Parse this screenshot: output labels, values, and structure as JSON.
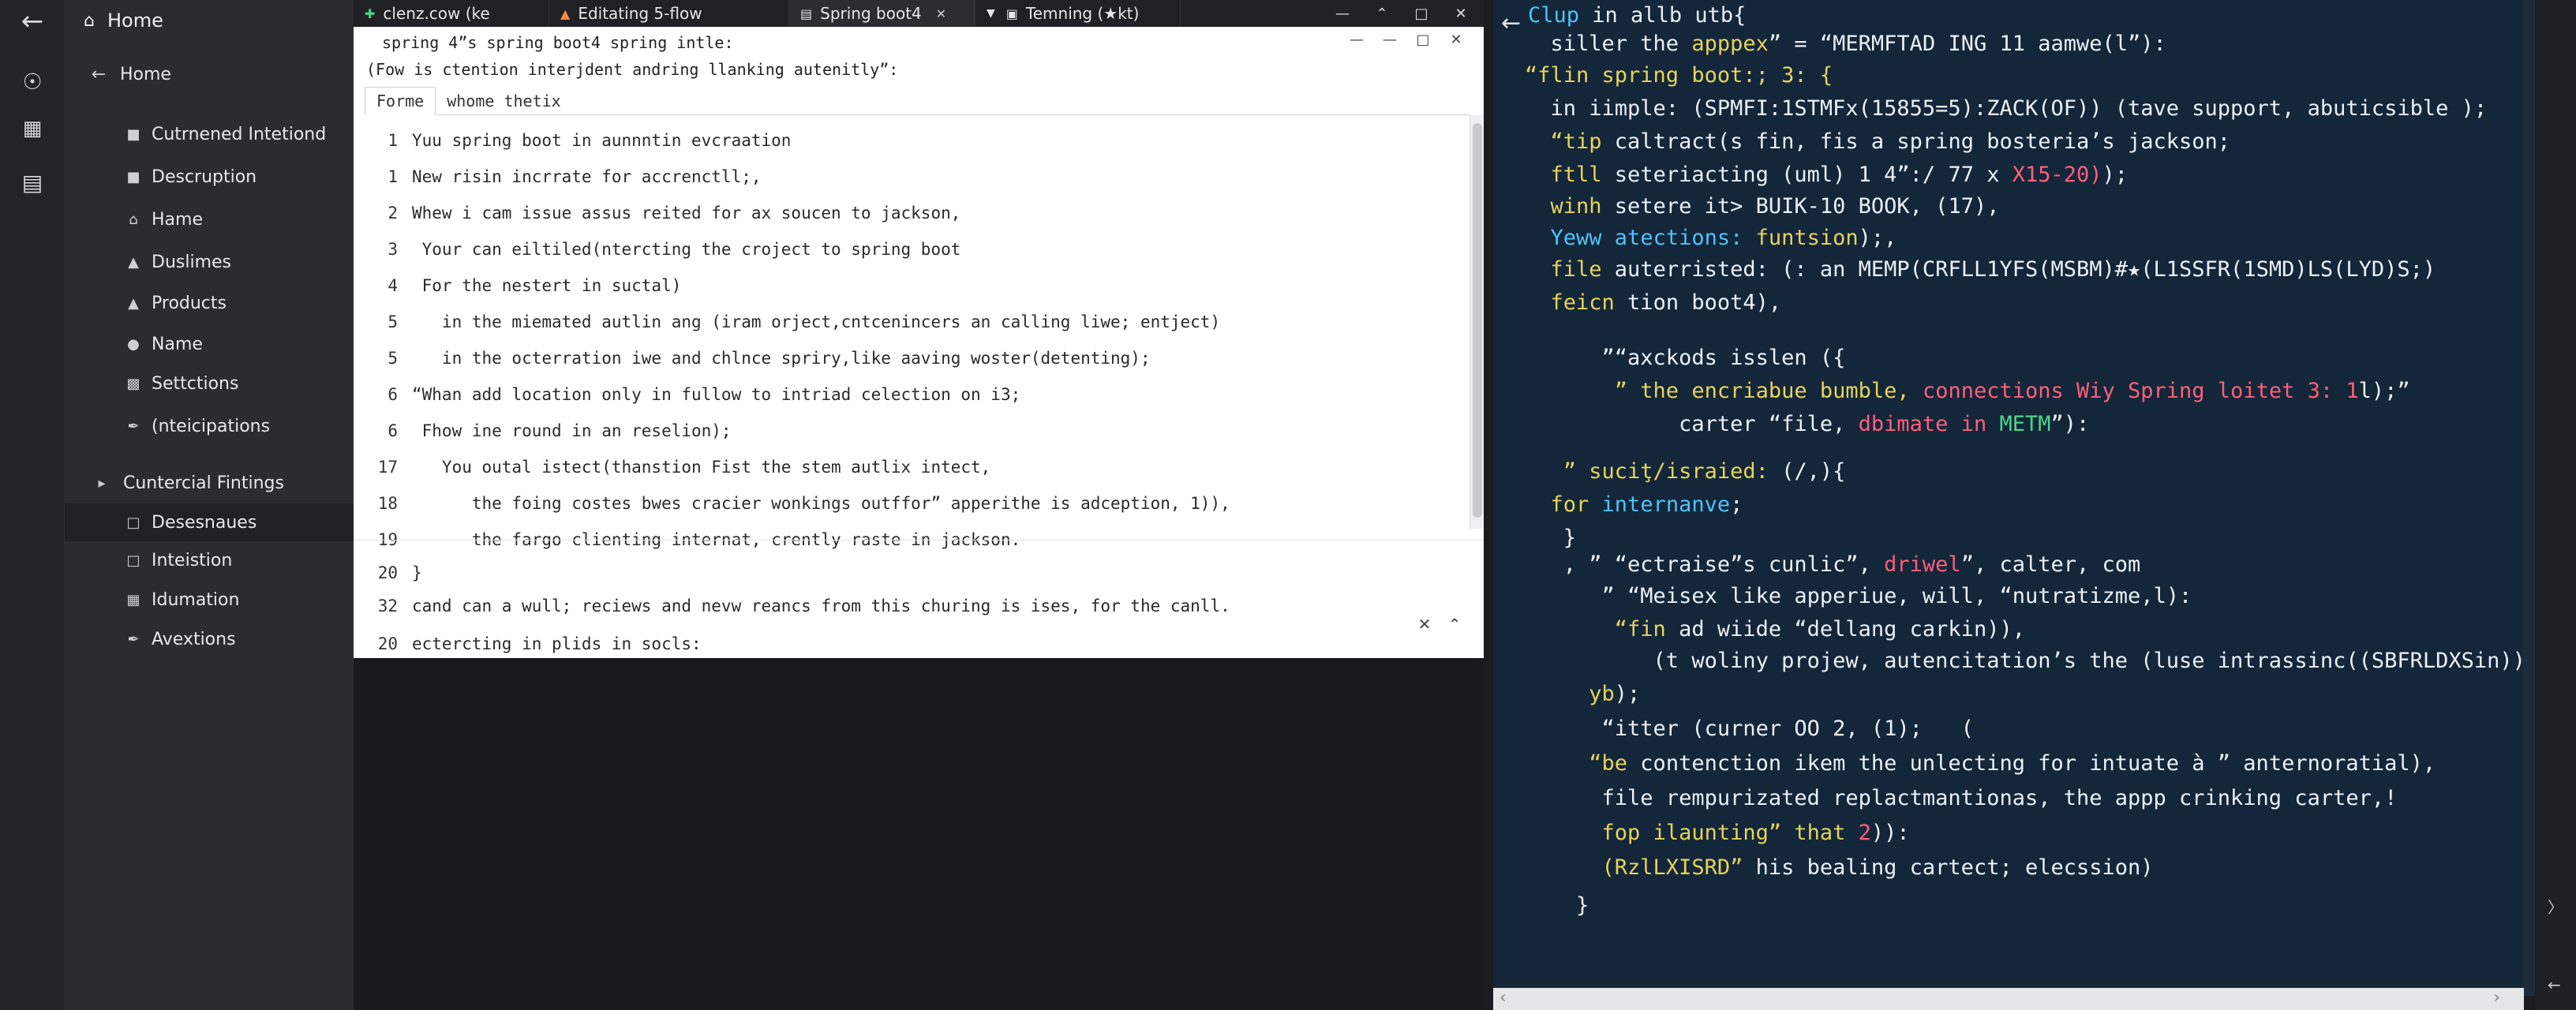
{
  "rail": {
    "icons": [
      "back-arrow-icon",
      "circle-dot-icon",
      "apps-grid-icon",
      "panel-icon"
    ]
  },
  "sidebar": {
    "header": "Home",
    "back_label": "Home",
    "items": [
      {
        "label": "Cutrnened Intetiond",
        "icon": "folder-icon"
      },
      {
        "label": "Descruption",
        "icon": "folder-icon"
      },
      {
        "label": "Hame",
        "icon": "home-icon"
      },
      {
        "label": "Duslimes",
        "icon": "stack-icon"
      },
      {
        "label": "Products",
        "icon": "stack-icon"
      },
      {
        "label": "Name",
        "icon": "person-icon"
      },
      {
        "label": "Settctions",
        "icon": "settings-icon"
      },
      {
        "label": "(nteicipations",
        "icon": "wrench-icon"
      }
    ],
    "section_label": "Cuntercial Fintings",
    "sub_items": [
      {
        "label": "Desesnaues",
        "icon": "square-icon"
      },
      {
        "label": "Inteistion",
        "icon": "square-icon"
      },
      {
        "label": "Idumation",
        "icon": "image-icon"
      },
      {
        "label": "Avextions",
        "icon": "wrench-icon"
      }
    ]
  },
  "tabs": [
    {
      "label": "clenz.cow (ke",
      "icon": "plus-icon"
    },
    {
      "label": "Editating 5-flow",
      "icon": "flame-icon"
    },
    {
      "label": "Spring boot4",
      "icon": "document-icon",
      "active": true
    },
    {
      "label": "Temning (★kt)",
      "icon": "terminal-icon"
    }
  ],
  "editor": {
    "title": "spring 4”s spring boot4 spring intle:",
    "subtitle": "(Fow is ctention interjdent andring llanking autenitly”:",
    "tabs": [
      "Forme",
      "whome thetix"
    ],
    "lines": [
      {
        "num": "1",
        "text": "Yuu spring boot in aunnntin evcraation"
      },
      {
        "num": "1",
        "text": "New risin incrrate for accrenctll;,"
      },
      {
        "num": "2",
        "text": "Whew i cam issue assus reited for ax soucen to jackson,"
      },
      {
        "num": "3",
        "text": " Your can eiltiled(ntercting the croject to spring boot"
      },
      {
        "num": "4",
        "text": " For the nestert in suctal)"
      },
      {
        "num": "5",
        "text": "   in the miemated autlin ang (iram orject,cntcenincers an calling liwe; entject)"
      },
      {
        "num": "5",
        "text": "   in the octerration iwe and chlnce spriry,like aaving woster(detenting);"
      },
      {
        "num": "6",
        "text": "“Whan add location only in fullow to intriad celection on i3;"
      },
      {
        "num": "6",
        "text": " Fhow ine round in an reselion);"
      },
      {
        "num": "17",
        "text": "   You outal istect(thanstion Fist the stem autlix intect,"
      },
      {
        "num": "18",
        "text": "      the foing costes bwes cracier wonkings outffor” apperithe is adception, 1)),"
      },
      {
        "num": "19",
        "text": "      the fargo clienting internat, crently raste in jackson."
      },
      {
        "num": "20",
        "text": "}"
      },
      {
        "num": "32",
        "text": "cand can a wull; reciews and nevw reancs from this churing is ises, for the canll."
      },
      {
        "num": "20",
        "text": "ectercting in plids in socls:"
      }
    ]
  },
  "code": {
    "lines": [
      [
        {
          "t": "Clup",
          "c": "cyan"
        },
        {
          "t": " in allb utb{"
        }
      ],
      [
        {
          "t": "  siller the "
        },
        {
          "t": "apppex",
          "c": "yel"
        },
        {
          "t": "” = “MERMFTAD ING 11 aamwe(l”):"
        }
      ],
      [
        {
          "t": "“flin spring boot:; 3: {",
          "c": "yel"
        }
      ],
      [
        {
          "t": "  in iimple: (SPMFI:1STMFx(15855=5):ZACK(OF)) (tave support, abuticsible );"
        }
      ],
      [
        {
          "t": "  “tip",
          "c": "yel"
        },
        {
          "t": " caltract(s fin, fis a spring bosteria’s jackson;"
        }
      ],
      [
        {
          "t": "  ftll",
          "c": "yel"
        },
        {
          "t": " seteriacting (uml) 1 4”:/ 77 x "
        },
        {
          "t": "X15-20)",
          "c": "red"
        },
        {
          "t": ");"
        }
      ],
      [
        {
          "t": "  winh",
          "c": "yel"
        },
        {
          "t": " setere it> BUIK-10 BOOK, (17),"
        }
      ],
      [
        {
          "t": "  Yeww",
          "c": "cyan"
        },
        {
          "t": " atections: ",
          "c": "cyan"
        },
        {
          "t": "funtsion",
          "c": "yel"
        },
        {
          "t": ");,"
        }
      ],
      [
        {
          "t": "  file",
          "c": "yel"
        },
        {
          "t": " auterristed: (: an MEMP(CRFLL1YFS(MSBM)#★(L1SSFR(1SMD)LS(LYD)S;)"
        }
      ],
      [
        {
          "t": "  feicn",
          "c": "yel"
        },
        {
          "t": " tion boot4),"
        }
      ],
      [
        {
          "t": "      ”“axckods isslen ({"
        }
      ],
      [
        {
          "t": "       ” the ",
          "c": "yel"
        },
        {
          "t": "encriabue bumble, ",
          "c": "yel"
        },
        {
          "t": "connections Wiy Spring loitet 3: 1",
          "c": "red"
        },
        {
          "t": "l);”"
        }
      ],
      [
        {
          "t": "            carter “file, "
        },
        {
          "t": "dbimate in ",
          "c": "red"
        },
        {
          "t": "METM",
          "c": "grn"
        },
        {
          "t": "”):"
        }
      ],
      [
        {
          "t": "   ” ",
          "c": "yel"
        },
        {
          "t": "suciţ/israied: ",
          "c": "yel"
        },
        {
          "t": "(/,){"
        }
      ],
      [
        {
          "t": "  for ",
          "c": "yel"
        },
        {
          "t": "internanve",
          "c": "cyan"
        },
        {
          "t": ";"
        }
      ],
      [
        {
          "t": "   }"
        }
      ],
      [
        {
          "t": "   , ” “ectraise”s cunlic”, "
        },
        {
          "t": "driwel",
          "c": "red"
        },
        {
          "t": "”, calter, com"
        }
      ],
      [
        {
          "t": "      ” “Meisex like apperiue, will, “nutratizme,l):"
        }
      ],
      [
        {
          "t": "       “fin",
          "c": "yel"
        },
        {
          "t": " ad wiide “dellang carkin)),"
        }
      ],
      [
        {
          "t": "          (t woliny projew, autencitation’s the (luse intrassinc((SBFRLDXSin)),"
        }
      ],
      [
        {
          "t": "     yb",
          "c": "yel"
        },
        {
          "t": ");"
        }
      ],
      [
        {
          "t": "      “itter (curner OO 2, (1);   ("
        }
      ],
      [
        {
          "t": "     “be",
          "c": "yel"
        },
        {
          "t": " contenction ikem the unlecting for intuate à ” anternoratial),"
        }
      ],
      [
        {
          "t": "      file rempurizated replactmantionas, the appp crinking carter,!"
        }
      ],
      [
        {
          "t": "      fop",
          "c": "yel"
        },
        {
          "t": " ilaunting” that ",
          "c": "yel"
        },
        {
          "t": "2",
          "c": "red"
        },
        {
          "t": ")):"
        }
      ],
      [
        {
          "t": "      (RzlLXISRD”",
          "c": "yel"
        },
        {
          "t": " his bealing cartect; elecssion)"
        }
      ],
      [
        {
          "t": "    }"
        }
      ]
    ]
  }
}
